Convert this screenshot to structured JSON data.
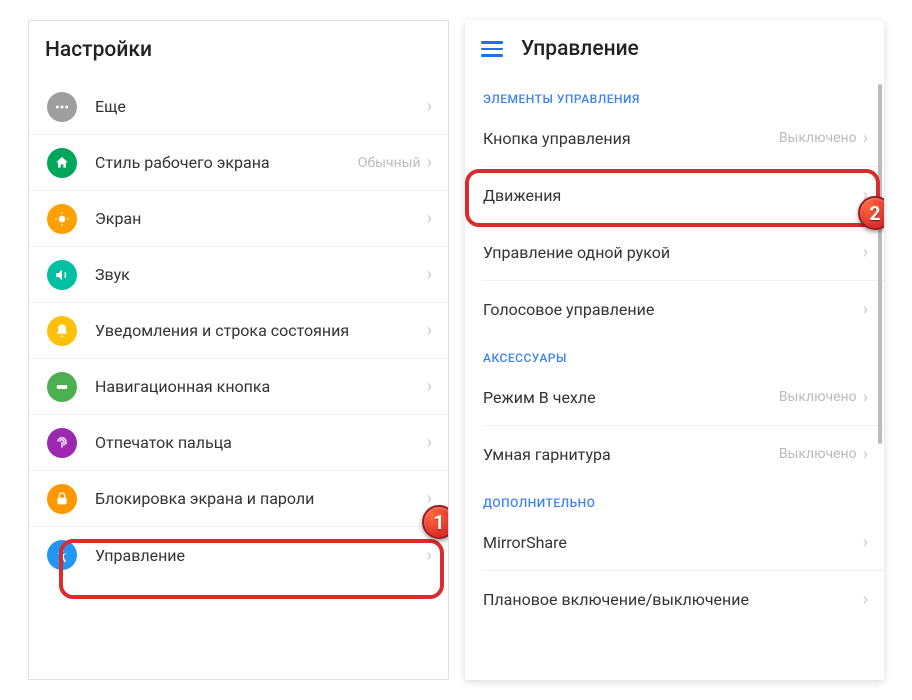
{
  "left": {
    "title": "Настройки",
    "items": [
      {
        "label": "Еще",
        "value": ""
      },
      {
        "label": "Стиль рабочего экрана",
        "value": "Обычный"
      },
      {
        "label": "Экран",
        "value": ""
      },
      {
        "label": "Звук",
        "value": ""
      },
      {
        "label": "Уведомления и строка состояния",
        "value": ""
      },
      {
        "label": "Навигационная кнопка",
        "value": ""
      },
      {
        "label": "Отпечаток пальца",
        "value": ""
      },
      {
        "label": "Блокировка экрана и пароли",
        "value": ""
      },
      {
        "label": "Управление",
        "value": ""
      }
    ]
  },
  "right": {
    "title": "Управление",
    "sections": [
      {
        "header": "ЭЛЕМЕНТЫ УПРАВЛЕНИЯ",
        "items": [
          {
            "label": "Кнопка управления",
            "value": "Выключено"
          },
          {
            "label": "Движения",
            "value": ""
          },
          {
            "label": "Управление одной рукой",
            "value": ""
          },
          {
            "label": "Голосовое управление",
            "value": ""
          }
        ]
      },
      {
        "header": "АКСЕССУАРЫ",
        "items": [
          {
            "label": "Режим В чехле",
            "value": "Выключено"
          },
          {
            "label": "Умная гарнитура",
            "value": "Выключено"
          }
        ]
      },
      {
        "header": "ДОПОЛНИТЕЛЬНО",
        "items": [
          {
            "label": "MirrorShare",
            "value": ""
          },
          {
            "label": "Плановое включение/выключение",
            "value": ""
          }
        ]
      }
    ]
  },
  "badges": {
    "one": "1",
    "two": "2"
  }
}
